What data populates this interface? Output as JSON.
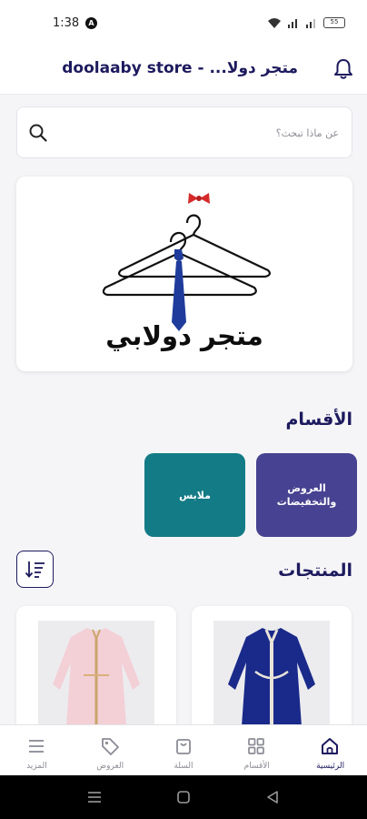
{
  "status_bar": {
    "time": "1:38",
    "notification_letter": "A",
    "battery": "55"
  },
  "header": {
    "title": "متجر دولا... - doolaaby store",
    "bell_icon": "bell-icon"
  },
  "search": {
    "placeholder": "عن ماذا تبحث؟",
    "icon": "search-icon"
  },
  "banner": {
    "brand_text": "متجر دولابي",
    "logo": "hangers-with-tie-and-bow-logo"
  },
  "categories": {
    "title": "الأقسام",
    "items": [
      {
        "label": "العروض والتخفيضات",
        "color": "#474291"
      },
      {
        "label": "ملابس",
        "color": "#137b86"
      }
    ]
  },
  "products": {
    "title": "المنتجات",
    "sort_icon": "sort-icon",
    "items": [
      {
        "image": "pink-embroidered-kaftan"
      },
      {
        "image": "blue-embroidered-kaftan"
      }
    ]
  },
  "bottom_nav": {
    "items": [
      {
        "label": "الرئيسية",
        "icon": "home-icon",
        "active": true
      },
      {
        "label": "الأقسام",
        "icon": "grid-icon",
        "active": false
      },
      {
        "label": "السلة",
        "icon": "cart-icon",
        "active": false
      },
      {
        "label": "العروض",
        "icon": "tag-icon",
        "active": false
      },
      {
        "label": "المزيد",
        "icon": "menu-icon",
        "active": false
      }
    ]
  },
  "colors": {
    "primary": "#1d1a5e",
    "offers_card": "#474291",
    "clothes_card": "#137b86",
    "bow": "#d62a2a",
    "tie": "#1f3c9c"
  }
}
